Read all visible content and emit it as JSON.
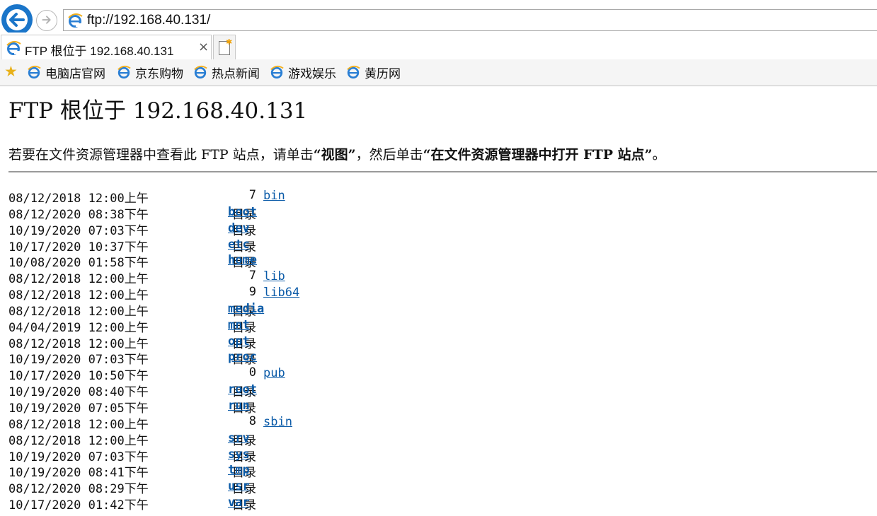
{
  "browser": {
    "url": "ftp://192.168.40.131/",
    "tab_title": "FTP 根位于 192.168.40.131",
    "tab_close": "×",
    "favorites": [
      "电脑店官网",
      "京东购物",
      "热点新闻",
      "游戏娱乐",
      "黄历网"
    ],
    "colors": {
      "accent": "#1a75c9",
      "link": "#0b5ba8"
    }
  },
  "page": {
    "title": "FTP 根位于 192.168.40.131",
    "instr_1": "若要在文件资源管理器中查看此 FTP 站点，请单击",
    "instr_2": "“视图”",
    "instr_3": "，然后单击",
    "instr_4": "“在文件资源管理器中打开 FTP 站点”",
    "instr_5": "。"
  },
  "listing": [
    {
      "date": "08/12/2018 12:00上午",
      "size": "7",
      "name": "bin",
      "dir": false
    },
    {
      "date": "08/12/2020 08:38下午",
      "size": "目录",
      "name": "boot",
      "dir": true
    },
    {
      "date": "10/19/2020 07:03下午",
      "size": "目录",
      "name": "dev",
      "dir": true
    },
    {
      "date": "10/17/2020 10:37下午",
      "size": "目录",
      "name": "etc",
      "dir": true
    },
    {
      "date": "10/08/2020 01:58下午",
      "size": "目录",
      "name": "home",
      "dir": true
    },
    {
      "date": "08/12/2018 12:00上午",
      "size": "7",
      "name": "lib",
      "dir": false
    },
    {
      "date": "08/12/2018 12:00上午",
      "size": "9",
      "name": "lib64",
      "dir": false
    },
    {
      "date": "08/12/2018 12:00上午",
      "size": "目录",
      "name": "media",
      "dir": true
    },
    {
      "date": "04/04/2019 12:00上午",
      "size": "目录",
      "name": "mnt",
      "dir": true
    },
    {
      "date": "08/12/2018 12:00上午",
      "size": "目录",
      "name": "opt",
      "dir": true
    },
    {
      "date": "10/19/2020 07:03下午",
      "size": "目录",
      "name": "proc",
      "dir": true
    },
    {
      "date": "10/17/2020 10:50下午",
      "size": "0",
      "name": "pub",
      "dir": false
    },
    {
      "date": "10/19/2020 08:40下午",
      "size": "目录",
      "name": "root",
      "dir": true
    },
    {
      "date": "10/19/2020 07:05下午",
      "size": "目录",
      "name": "run",
      "dir": true
    },
    {
      "date": "08/12/2018 12:00上午",
      "size": "8",
      "name": "sbin",
      "dir": false
    },
    {
      "date": "08/12/2018 12:00上午",
      "size": "目录",
      "name": "srv",
      "dir": true
    },
    {
      "date": "10/19/2020 07:03下午",
      "size": "目录",
      "name": "sys",
      "dir": true
    },
    {
      "date": "10/19/2020 08:41下午",
      "size": "目录",
      "name": "tmp",
      "dir": true
    },
    {
      "date": "08/12/2020 08:29下午",
      "size": "目录",
      "name": "usr",
      "dir": true
    },
    {
      "date": "10/17/2020 01:42下午",
      "size": "目录",
      "name": "var",
      "dir": true
    }
  ]
}
